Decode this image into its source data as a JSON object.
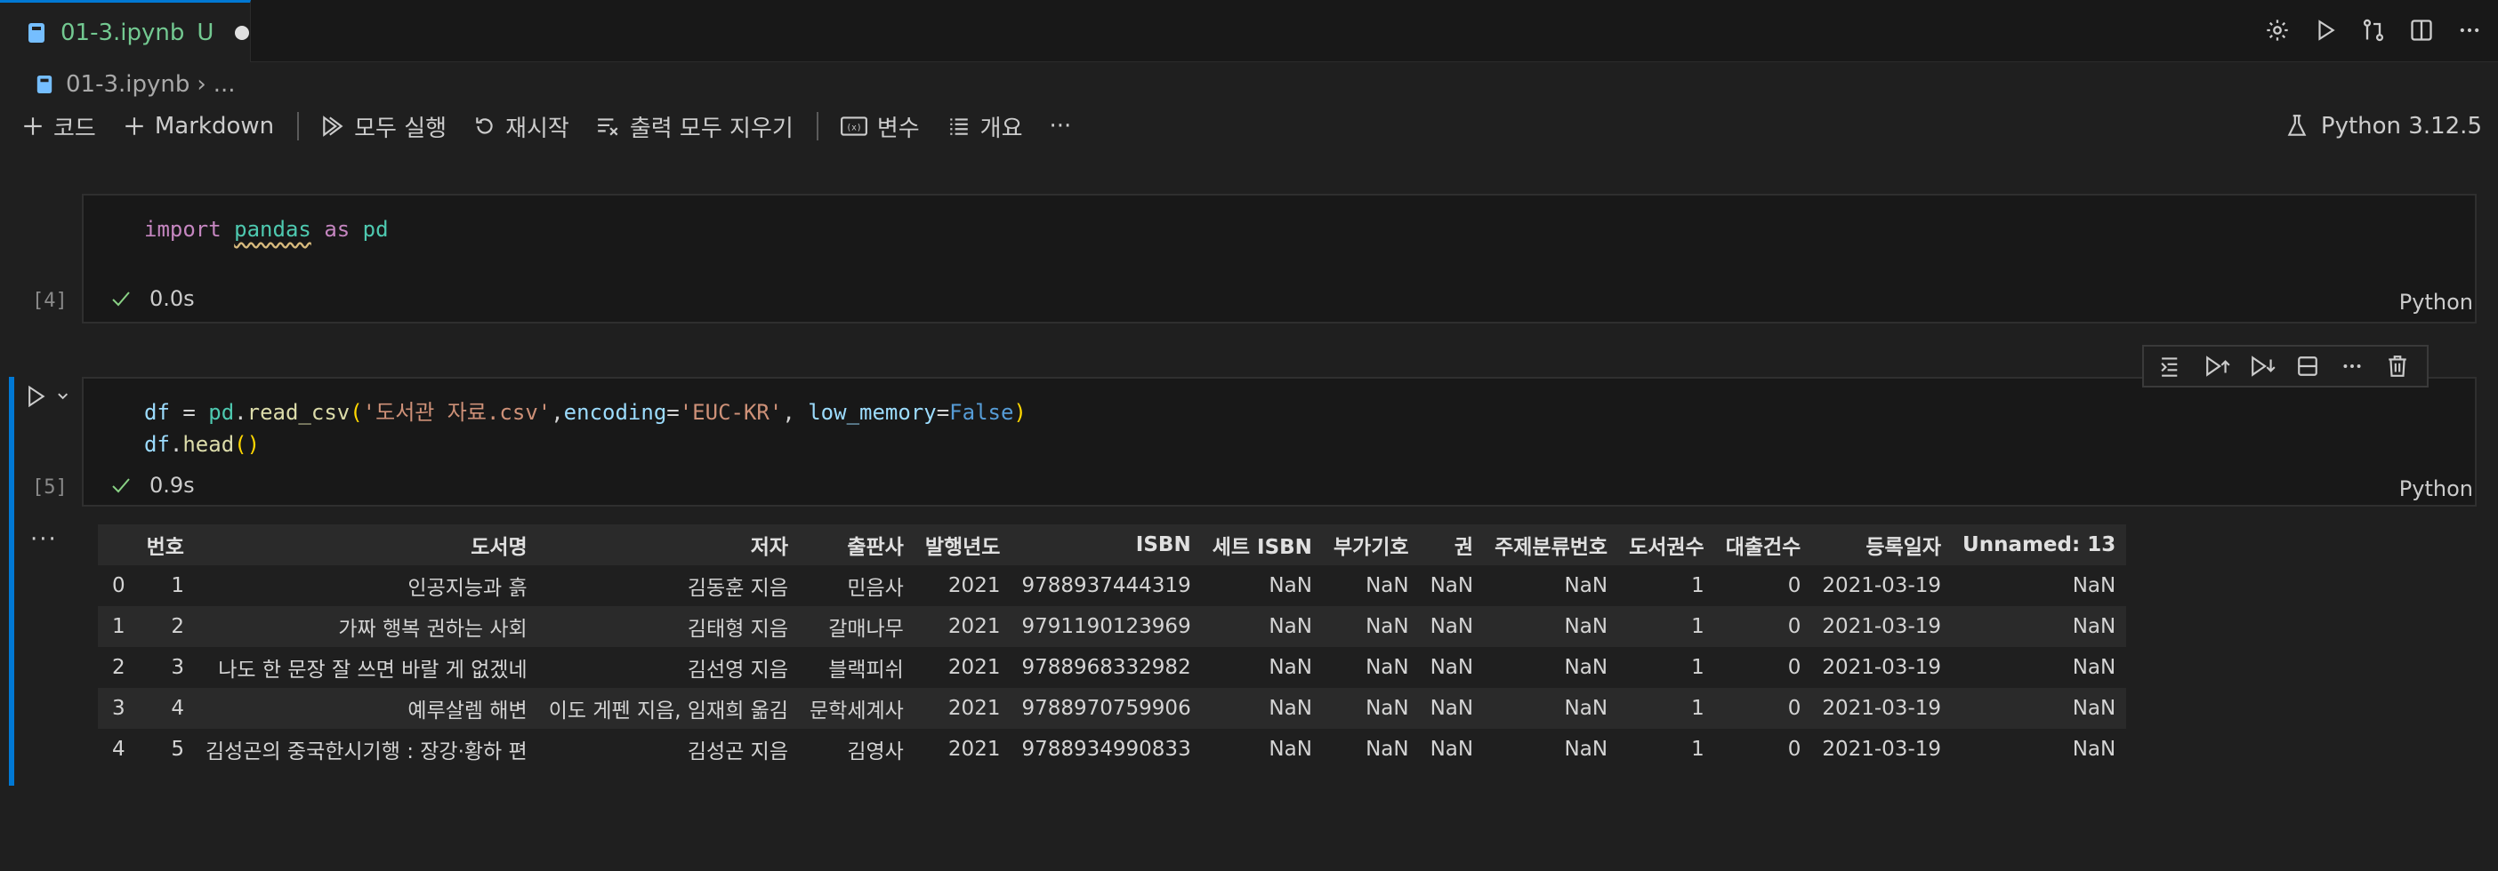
{
  "tab": {
    "name": "01-3.ipynb",
    "status": "U"
  },
  "breadcrumb": {
    "file": "01-3.ipynb",
    "rest": "..."
  },
  "toolbar": {
    "code": "코드",
    "markdown": "Markdown",
    "run_all": "모두 실행",
    "restart": "재시작",
    "clear_outputs": "출력 모두 지우기",
    "variables": "변수",
    "outline": "개요",
    "more": "···"
  },
  "kernel": {
    "label": "Python 3.12.5"
  },
  "cells": [
    {
      "exec_count": "[4]",
      "time": "0.0s",
      "lang": "Python",
      "code": {
        "kw1": "import",
        "mod": "pandas",
        "kw2": "as",
        "alias": "pd"
      }
    },
    {
      "exec_count": "[5]",
      "time": "0.9s",
      "lang": "Python",
      "code": {
        "df": "df",
        "eq": " = ",
        "pd": "pd",
        "dot": ".",
        "fn": "read_csv",
        "open": "(",
        "file": "'도서관 자료.csv'",
        "comma1": ",",
        "p1": "encoding",
        "eq1": "=",
        "enc": "'EUC-KR'",
        "comma2": ", ",
        "p2": "low_memory",
        "eq2": "=",
        "bool": "False",
        "close": ")",
        "line2_df": "df",
        "line2_dot": ".",
        "line2_fn": "head",
        "line2_parens": "()"
      }
    }
  ],
  "output": {
    "more": "···",
    "columns": [
      "",
      "번호",
      "도서명",
      "저자",
      "출판사",
      "발행년도",
      "ISBN",
      "세트 ISBN",
      "부가기호",
      "권",
      "주제분류번호",
      "도서권수",
      "대출건수",
      "등록일자",
      "Unnamed: 13"
    ],
    "rows": [
      [
        "0",
        "1",
        "인공지능과 흙",
        "김동훈 지음",
        "민음사",
        "2021",
        "9788937444319",
        "NaN",
        "NaN",
        "NaN",
        "NaN",
        "1",
        "0",
        "2021-03-19",
        "NaN"
      ],
      [
        "1",
        "2",
        "가짜 행복 권하는 사회",
        "김태형 지음",
        "갈매나무",
        "2021",
        "9791190123969",
        "NaN",
        "NaN",
        "NaN",
        "NaN",
        "1",
        "0",
        "2021-03-19",
        "NaN"
      ],
      [
        "2",
        "3",
        "나도 한 문장 잘 쓰면 바랄 게 없겠네",
        "김선영 지음",
        "블랙피쉬",
        "2021",
        "9788968332982",
        "NaN",
        "NaN",
        "NaN",
        "NaN",
        "1",
        "0",
        "2021-03-19",
        "NaN"
      ],
      [
        "3",
        "4",
        "예루살렘 해변",
        "이도 게펜 지음, 임재희 옮김",
        "문학세계사",
        "2021",
        "9788970759906",
        "NaN",
        "NaN",
        "NaN",
        "NaN",
        "1",
        "0",
        "2021-03-19",
        "NaN"
      ],
      [
        "4",
        "5",
        "김성곤의 중국한시기행 : 장강·황하 편",
        "김성곤 지음",
        "김영사",
        "2021",
        "9788934990833",
        "NaN",
        "NaN",
        "NaN",
        "NaN",
        "1",
        "0",
        "2021-03-19",
        "NaN"
      ]
    ]
  }
}
